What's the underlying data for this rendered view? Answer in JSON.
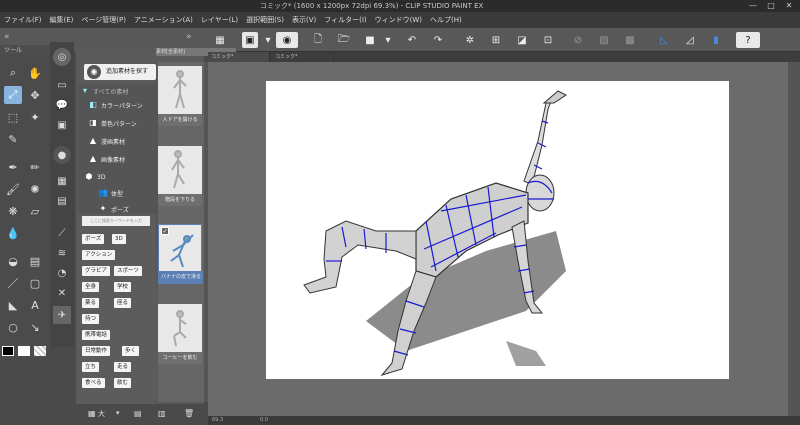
{
  "window": {
    "title": "コミック* (1600 x 1200px 72dpi 69.3%)  - CLIP STUDIO PAINT EX",
    "minimize": "—",
    "maximize": "□",
    "close": "✕"
  },
  "menu": [
    "ファイル(F)",
    "編集(E)",
    "ページ管理(P)",
    "アニメーション(A)",
    "レイヤー(L)",
    "選択範囲(S)",
    "表示(V)",
    "フィルター(I)",
    "ウィンドウ(W)",
    "ヘルプ(H)"
  ],
  "tool_panel": {
    "header": "ツール"
  },
  "material_panel": {
    "tab": "素材[全素材]",
    "search_button": "追加素材を探す",
    "tree": [
      {
        "label": "すべての素材",
        "icon": "folder-icon"
      },
      {
        "label": "カラーパターン",
        "icon": "color-pattern-icon"
      },
      {
        "label": "単色パターン",
        "icon": "mono-pattern-icon"
      },
      {
        "label": "漫画素材",
        "icon": "manga-icon"
      },
      {
        "label": "画像素材",
        "icon": "image-icon"
      },
      {
        "label": "3D",
        "icon": "cube-icon"
      },
      {
        "label": "体型",
        "icon": "body-icon"
      },
      {
        "label": "ポーズ",
        "icon": "pose-icon"
      }
    ],
    "tag_search_placeholder": "ここに検索キーワードを入力",
    "tags": [
      "ポーズ",
      "3D",
      "アクション",
      "グラビア",
      "スポーツ",
      "全身",
      "学校",
      "薬る",
      "座る",
      "持つ",
      "携帯電話",
      "日常動作",
      "歩く",
      "立ち",
      "走る",
      "食べる",
      "飲む"
    ],
    "thumbnails": [
      {
        "label": "人ドアを開ける",
        "selected": false
      },
      {
        "label": "階段を下りる",
        "selected": false
      },
      {
        "label": "バナナの皮で滑る",
        "selected": true
      },
      {
        "label": "コーヒーを飲む",
        "selected": false
      }
    ],
    "bottom": {
      "view": "大"
    }
  },
  "doc_tabs": [
    "コミック*",
    "コミック*"
  ],
  "status": {
    "zoom": "69.3",
    "value": "0.0"
  }
}
